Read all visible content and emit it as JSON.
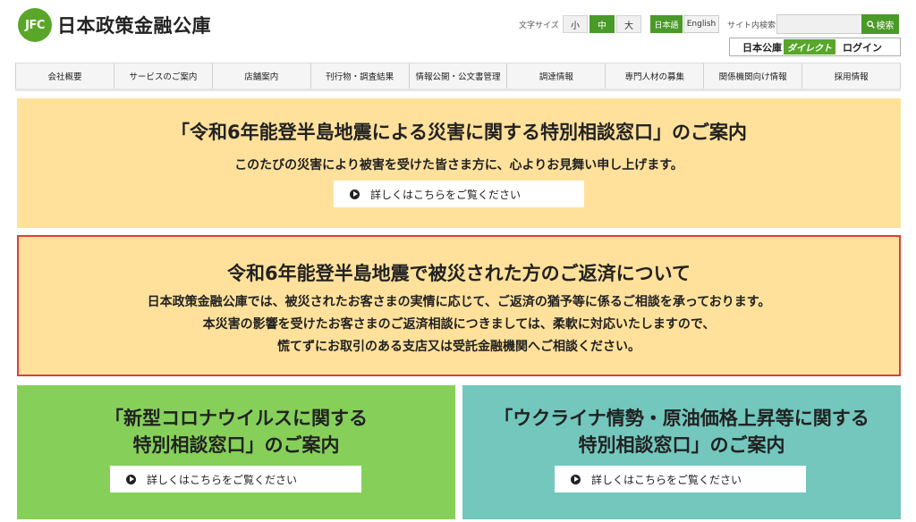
{
  "header": {
    "logo_mark": "JFC",
    "logo_text": "日本政策金融公庫",
    "font_size_label": "文字サイズ",
    "font_sizes": [
      "小",
      "中",
      "大"
    ],
    "font_size_active": "中",
    "languages": [
      "日本語",
      "English"
    ],
    "search_label": "サイト内検索",
    "search_placeholder": "",
    "search_button": "検索",
    "direct": {
      "prefix": "日本公庫",
      "badge": "ダイレクト",
      "login": "ログイン"
    }
  },
  "nav": {
    "items": [
      "会社概要",
      "サービスのご案内",
      "店舗案内",
      "刊行物・調査結果",
      "情報公開・公文書管理",
      "調達情報",
      "専門人材の募集",
      "関係機関向け情報",
      "採用情報"
    ]
  },
  "banners": {
    "noto_consult": {
      "title": "「令和6年能登半島地震による災害に関する特別相談窓口」のご案内",
      "subtitle": "このたびの災害により被害を受けた皆さま方に、心よりお見舞い申し上げます。",
      "button": "詳しくはこちらをご覧ください"
    },
    "noto_repay": {
      "title": "令和6年能登半島地震で被災された方のご返済について",
      "lines": [
        "日本政策金融公庫では、被災されたお客さまの実情に応じて、ご返済の猶予等に係るご相談を承っております。",
        "本災害の影響を受けたお客さまのご返済相談につきましては、柔軟に対応いたしますので、",
        "慌てずにお取引のある支店又は受託金融機関へご相談ください。"
      ]
    },
    "corona": {
      "title_line1": "「新型コロナウイルスに関する",
      "title_line2": "特別相談窓口」のご案内",
      "button": "詳しくはこちらをご覧ください"
    },
    "ukraine": {
      "title_line1": "「ウクライナ情勢・原油価格上昇等に関する",
      "title_line2": "特別相談窓口」のご案内",
      "button": "詳しくはこちらをご覧ください"
    }
  },
  "colors": {
    "brand_green": "#5aa62a",
    "banner_yellow": "#ffe19b",
    "alert_red": "#d9413a",
    "corona_green": "#86d05a",
    "ukraine_teal": "#73c7bd"
  }
}
